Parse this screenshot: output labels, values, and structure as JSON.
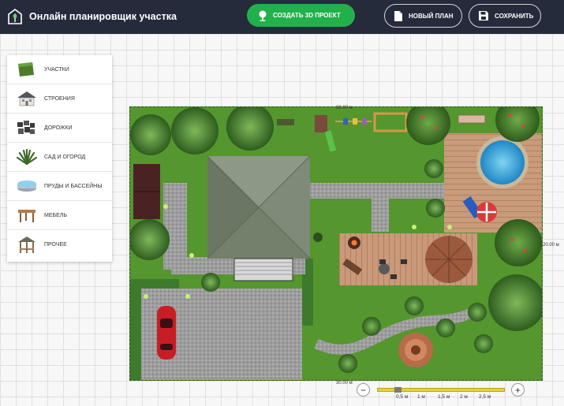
{
  "header": {
    "app_title": "Онлайн планировщик участка",
    "create_3d_label": "СОЗДАТЬ 3D ПРОЕКТ",
    "new_plan_label": "НОВЫЙ ПЛАН",
    "save_label": "СОХРАНИТЬ",
    "icons": [
      "house-logo-icon",
      "tree-icon",
      "document-icon",
      "floppy-disk-icon"
    ]
  },
  "menu": {
    "items": [
      {
        "label": "УЧАСТКИ",
        "icon": "lawn-tile-icon"
      },
      {
        "label": "СТРОЕНИЯ",
        "icon": "house-icon"
      },
      {
        "label": "ДОРОЖКИ",
        "icon": "paving-tile-icon"
      },
      {
        "label": "САД И ОГОРОД",
        "icon": "plant-icon"
      },
      {
        "label": "ПРУДЫ И БАССЕЙНЫ",
        "icon": "pool-icon"
      },
      {
        "label": "МЕБЕЛЬ",
        "icon": "table-icon"
      },
      {
        "label": "ПРОЧЕЕ",
        "icon": "gazebo-icon"
      }
    ]
  },
  "plan": {
    "dim_top": "30.00 м",
    "dim_right": "20.00 м",
    "dim_bottom": "30.00 м"
  },
  "zoom": {
    "minus_label": "−",
    "plus_label": "+",
    "scale_labels": [
      "0,5 м",
      "1 м",
      "1,5 м",
      "2 м",
      "2,5 м"
    ]
  },
  "colors": {
    "topbar": "#262b3b",
    "accent_green": "#22b04b",
    "lawn": "#55962f",
    "gravel": "#9c9c9c",
    "deck": "#c89b7b",
    "water": "#33a6d8",
    "scale_bar": "#e8d23a"
  }
}
